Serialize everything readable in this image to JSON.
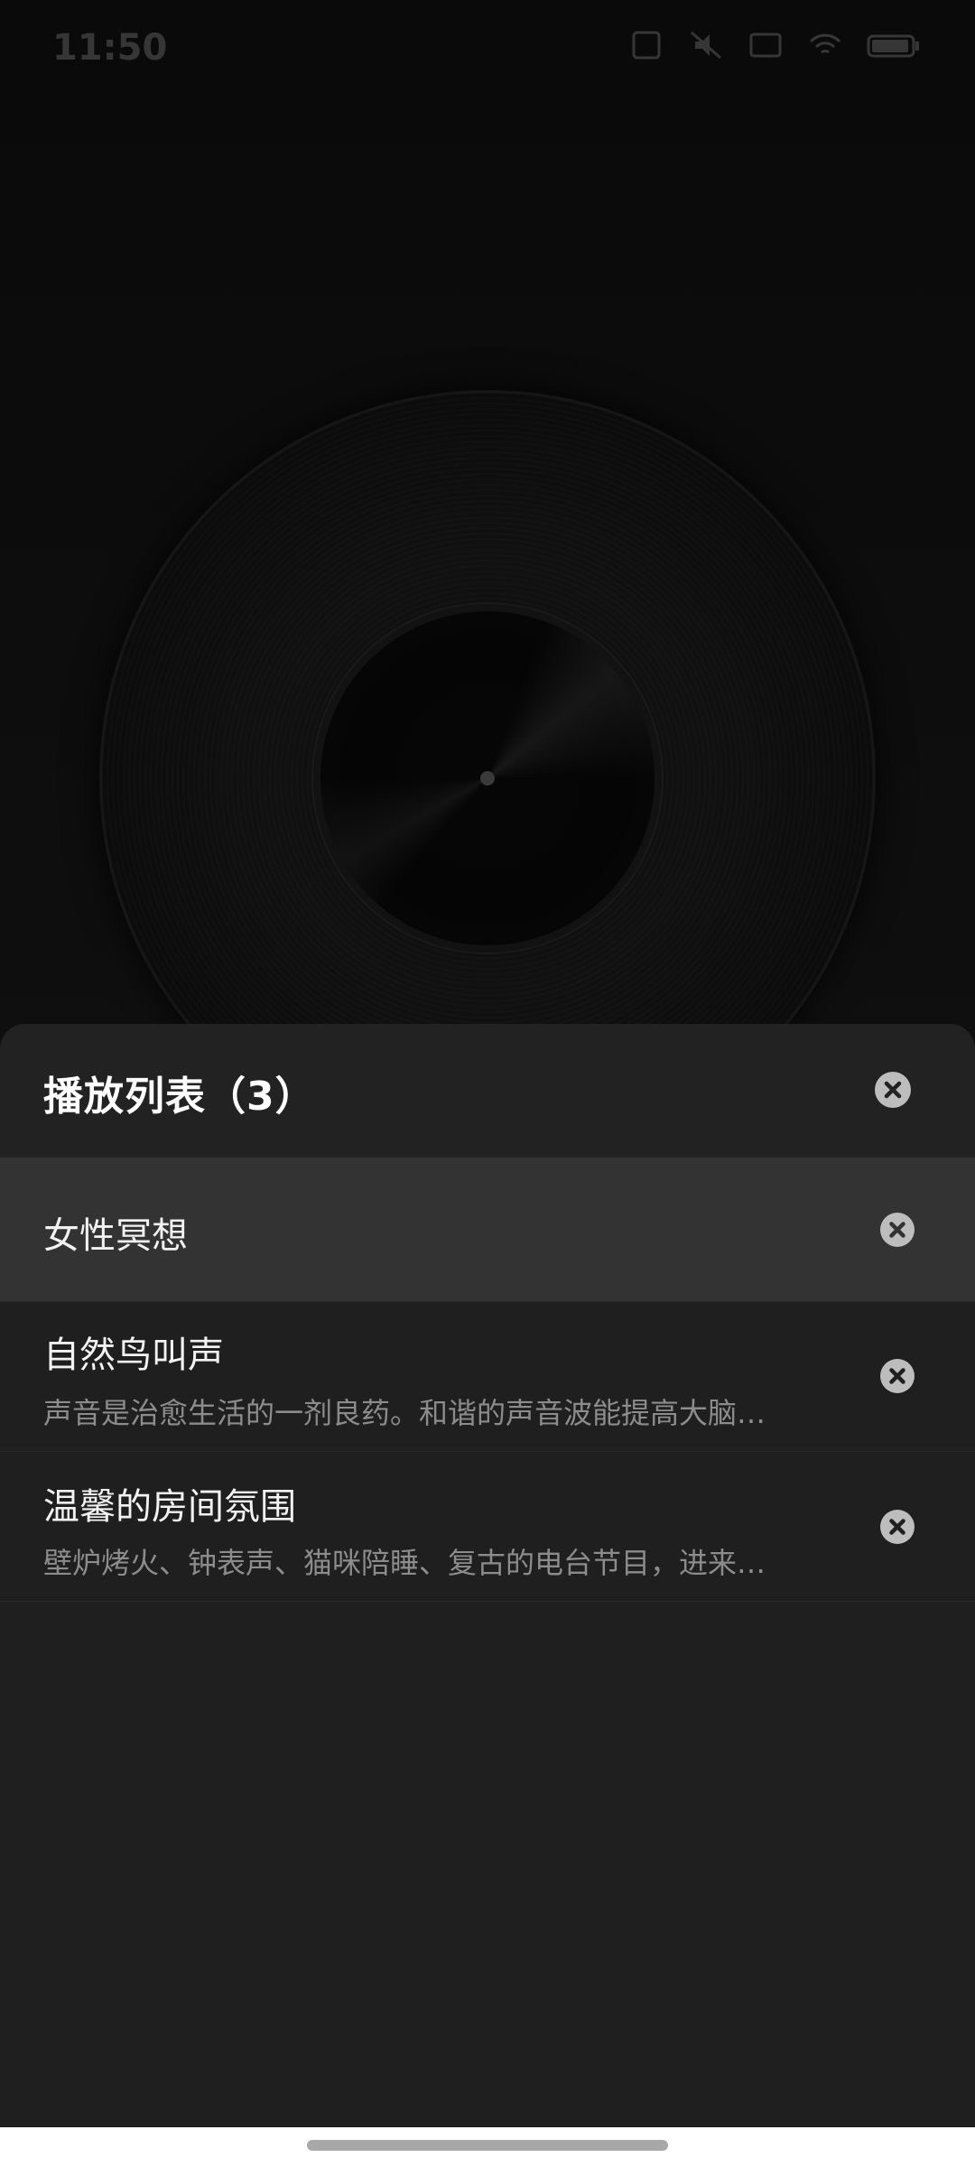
{
  "status_bar": {
    "time": "11:50",
    "icons": [
      "sim-icon",
      "mute-icon",
      "screenshot-icon",
      "wifi-icon",
      "battery-icon"
    ]
  },
  "player": {
    "artwork": "vinyl-record"
  },
  "playlist": {
    "title": "播放列表（3）",
    "items": [
      {
        "title": "女性冥想",
        "description": "",
        "active": true
      },
      {
        "title": "自然鸟叫声",
        "description": "声音是治愈生活的一剂良药。和谐的声音波能提高大脑…",
        "active": false
      },
      {
        "title": "温馨的房间氛围",
        "description": "壁炉烤火、钟表声、猫咪陪睡、复古的电台节目，进来…",
        "active": false
      }
    ]
  },
  "colors": {
    "sheet_bg": "#1f1f1f",
    "header_bg": "#222222",
    "active_row_bg": "#333333",
    "close_icon": "#bdbdbd",
    "desc_text": "#8c8c8c"
  }
}
